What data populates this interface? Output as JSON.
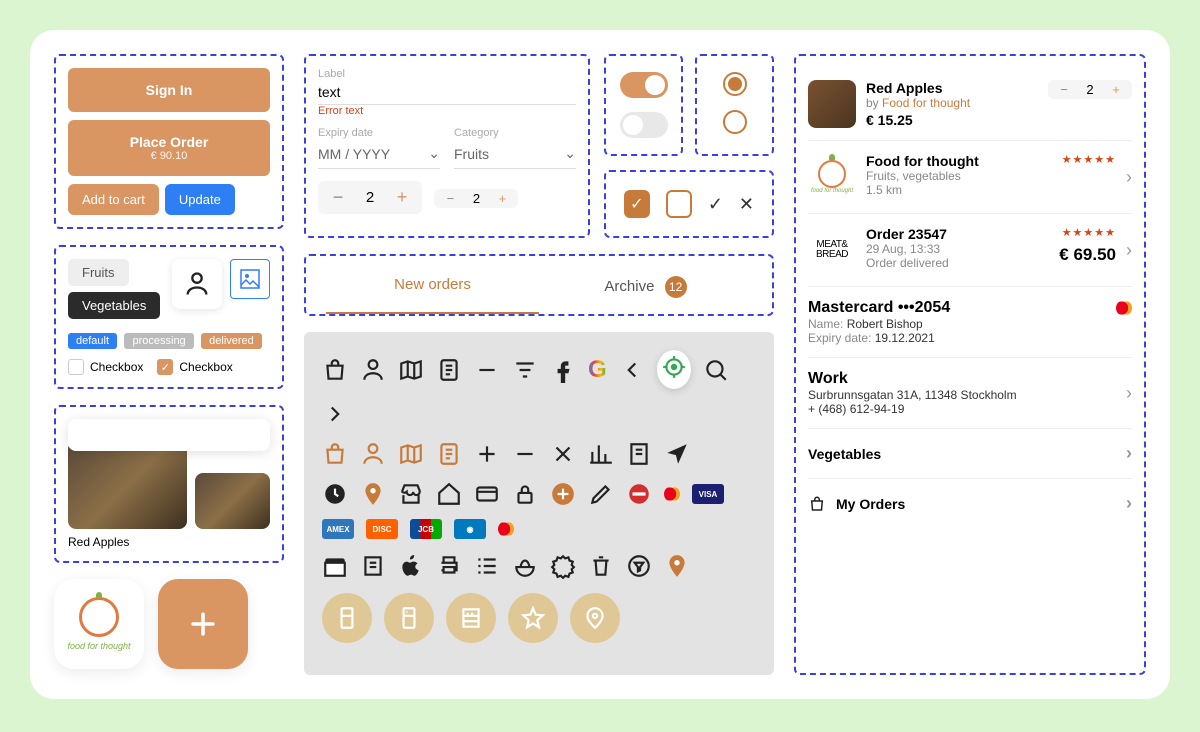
{
  "buttons": {
    "signin": "Sign In",
    "place_order": "Place Order",
    "place_order_sub": "€ 90.10",
    "add_to_cart": "Add to cart",
    "update": "Update"
  },
  "chips": {
    "fruits": "Fruits",
    "vegetables": "Vegetables"
  },
  "tags": {
    "default": "default",
    "processing": "processing",
    "delivered": "delivered"
  },
  "checkbox_label": "Checkbox",
  "product": {
    "caption": "Red Apples"
  },
  "logo_text": "food for thought",
  "form": {
    "label": "Label",
    "value": "text",
    "error": "Error text",
    "expiry_label": "Expiry date",
    "expiry_value": "MM / YYYY",
    "category_label": "Category",
    "category_value": "Fruits",
    "stepper1": "2",
    "stepper2": "2"
  },
  "tabs": {
    "new": "New orders",
    "archive": "Archive",
    "archive_count": "12"
  },
  "cart_item": {
    "title": "Red Apples",
    "by_prefix": "by",
    "by_name": "Food for thought",
    "price": "€ 15.25",
    "qty": "2"
  },
  "vendor": {
    "name": "Food for thought",
    "tags": "Fruits, vegetables",
    "distance": "1.5 km"
  },
  "order": {
    "title": "Order 23547",
    "time": "29 Aug, 13:33",
    "status": "Order delivered",
    "total": "€ 69.50"
  },
  "payment": {
    "title": "Mastercard •••2054",
    "name_label": "Name:",
    "name": "Robert Bishop",
    "expiry_label": "Expiry date:",
    "expiry": "19.12.2021"
  },
  "address": {
    "title": "Work",
    "line": "Surbrunnsgatan 31A, 11348 Stockholm",
    "phone": "+ (468) 612-94-19"
  },
  "cat_row": "Vegetables",
  "orders_row": "My Orders"
}
